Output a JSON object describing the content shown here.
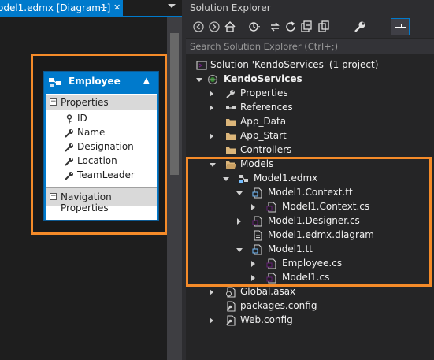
{
  "designer": {
    "tab_title": "odel1.edmx [Diagram1]",
    "pin_glyph": "⊹",
    "close_glyph": "✕",
    "entity": {
      "name": "Employee",
      "sections": {
        "properties_label": "Properties",
        "navigation_label": "Navigation Properties"
      },
      "properties": [
        "ID",
        "Name",
        "Designation",
        "Location",
        "TeamLeader"
      ]
    }
  },
  "solution_explorer": {
    "title": "Solution Explorer",
    "search_placeholder": "Search Solution Explorer (Ctrl+;)",
    "toolbar_icons": [
      "back-icon",
      "forward-icon",
      "home-icon",
      "pending-changes-icon",
      "sync-icon",
      "refresh-icon",
      "collapse-all-icon",
      "show-all-files-icon",
      "properties-icon",
      "preview-icon"
    ],
    "tree": [
      {
        "label": "Solution 'KendoServices' (1 project)",
        "icon": "solution-icon",
        "expander": "none"
      },
      {
        "label": "KendoServices",
        "icon": "web-project-icon",
        "expander": "expanded",
        "bold": true
      },
      {
        "label": "Properties",
        "icon": "wrench-icon",
        "expander": "collapsed"
      },
      {
        "label": "References",
        "icon": "references-icon",
        "expander": "collapsed"
      },
      {
        "label": "App_Data",
        "icon": "folder-icon",
        "expander": "none"
      },
      {
        "label": "App_Start",
        "icon": "folder-icon",
        "expander": "collapsed"
      },
      {
        "label": "Controllers",
        "icon": "folder-icon",
        "expander": "none"
      },
      {
        "label": "Models",
        "icon": "folder-open-icon",
        "expander": "expanded"
      },
      {
        "label": "Model1.edmx",
        "icon": "edmx-icon",
        "expander": "expanded"
      },
      {
        "label": "Model1.Context.tt",
        "icon": "tt-file-icon",
        "expander": "expanded"
      },
      {
        "label": "Model1.Context.cs",
        "icon": "cs-file-icon",
        "expander": "collapsed"
      },
      {
        "label": "Model1.Designer.cs",
        "icon": "cs-file-icon",
        "expander": "collapsed"
      },
      {
        "label": "Model1.edmx.diagram",
        "icon": "file-icon",
        "expander": "none"
      },
      {
        "label": "Model1.tt",
        "icon": "tt-file-icon",
        "expander": "expanded"
      },
      {
        "label": "Employee.cs",
        "icon": "cs-file-icon",
        "expander": "collapsed"
      },
      {
        "label": "Model1.cs",
        "icon": "cs-file-icon",
        "expander": "collapsed"
      },
      {
        "label": "Global.asax",
        "icon": "global-asax-icon",
        "expander": "collapsed"
      },
      {
        "label": "packages.config",
        "icon": "config-file-icon",
        "expander": "none"
      },
      {
        "label": "Web.config",
        "icon": "config-file-icon",
        "expander": "collapsed"
      }
    ]
  },
  "colors": {
    "accent": "#007acc",
    "highlight": "#f58b29",
    "background": "#252526"
  }
}
